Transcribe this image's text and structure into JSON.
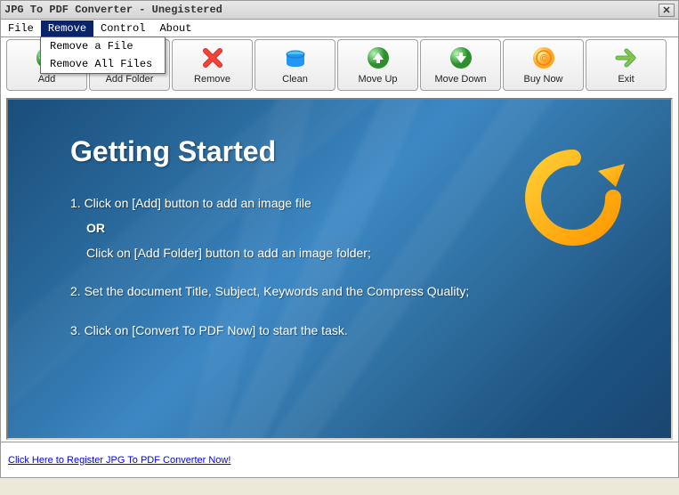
{
  "title": "JPG To PDF Converter - Unegistered",
  "menu": {
    "file": "File",
    "remove": "Remove",
    "control": "Control",
    "about": "About",
    "dropdown": {
      "removeFile": "Remove a File",
      "removeAll": "Remove All Files"
    }
  },
  "toolbar": {
    "add": "Add",
    "addFolder": "Add Folder",
    "remove": "Remove",
    "clean": "Clean",
    "moveUp": "Move Up",
    "moveDown": "Move Down",
    "buyNow": "Buy Now",
    "exit": "Exit"
  },
  "panel": {
    "heading": "Getting Started",
    "step1a": "1. Click on [Add] button to add an image file",
    "or": "OR",
    "step1b": "Click on [Add Folder] button to add an image folder;",
    "step2": "2. Set the document Title, Subject, Keywords and the Compress Quality;",
    "step3": "3. Click on [Convert To PDF Now] to start the task."
  },
  "footer": {
    "link": "Click Here to Register JPG To PDF Converter Now!"
  }
}
